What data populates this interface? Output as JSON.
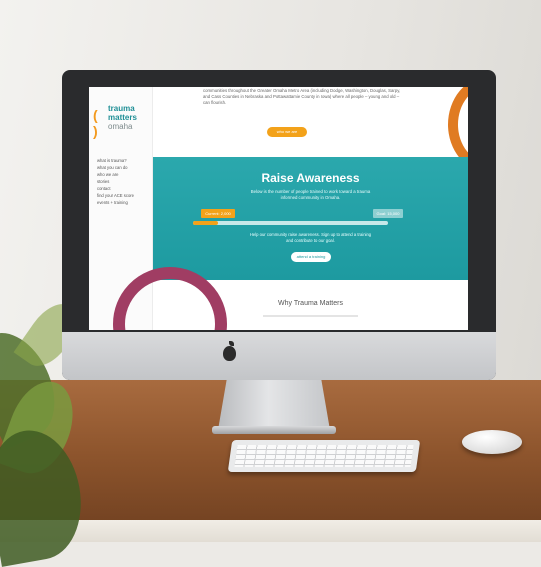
{
  "site": {
    "logo": {
      "bracket": "( )",
      "line1": "trauma",
      "line2": "matters",
      "line3": "omaha"
    },
    "nav": [
      "what is trauma?",
      "what you can do",
      "who we are",
      "stories",
      "contact",
      "find your ACE score",
      "events + training"
    ],
    "intro_text": "communities throughout the Greater Omaha Metro Area (including Dodge, Washington, Douglas, Sarpy, and Cass Counties in Nebraska and Pottawattamie County in Iowa) where all people – young and old – can flourish.",
    "who_button": "who we are",
    "awareness": {
      "title": "Raise Awareness",
      "subtitle": "Below is the number of people trained to work toward a trauma informed community in Omaha.",
      "current_label": "Current: 2,000",
      "goal_label": "Goal: 15,000",
      "progress": 0.13,
      "help_text": "Help our community raise awareness. Sign up to attend a training and contribute to our goal.",
      "attend_button": "attend a training"
    },
    "section_title": "Why Trauma Matters",
    "colors": {
      "teal": "#1d9aa0",
      "orange": "#f3a21a",
      "purple": "#a03d63"
    }
  }
}
